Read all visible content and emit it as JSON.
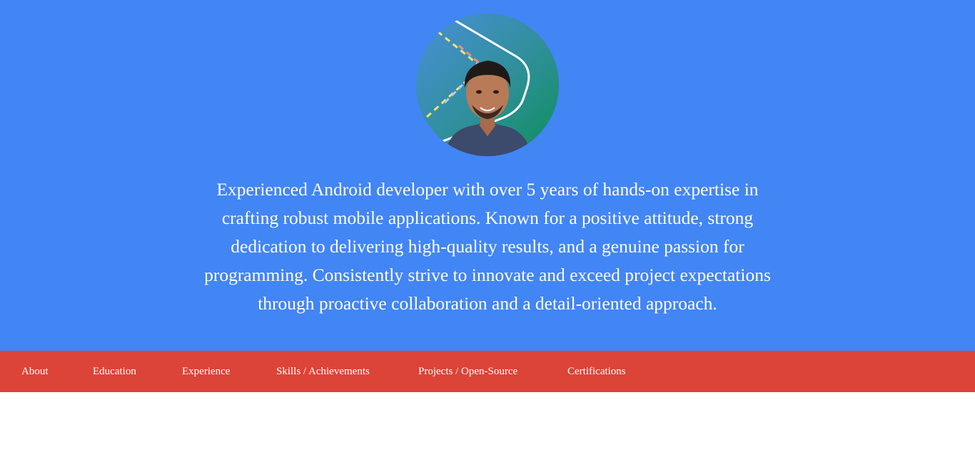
{
  "profile": {
    "photo_icon": "profile-photo",
    "bio": "Experienced Android developer with over 5 years of hands-on expertise in crafting robust mobile applications. Known for a positive attitude, strong dedication to delivering high-quality results, and a genuine passion for programming. Consistently strive to innovate and exceed project expectations through proactive collaboration and a detail-oriented approach."
  },
  "nav": {
    "items": [
      {
        "label": "About"
      },
      {
        "label": "Education"
      },
      {
        "label": "Experience"
      },
      {
        "label": "Skills / Achievements"
      },
      {
        "label": "Projects / Open-Source"
      },
      {
        "label": "Certifications"
      }
    ]
  },
  "colors": {
    "hero_background": "#4285f4",
    "nav_background": "#db4437",
    "text": "#ffffff"
  }
}
